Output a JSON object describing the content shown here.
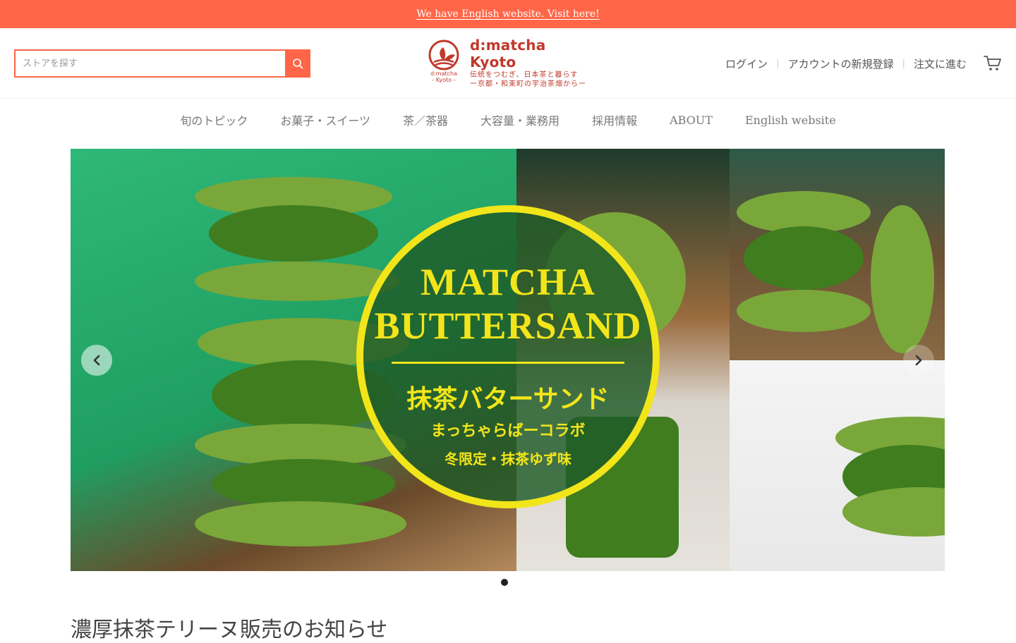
{
  "announcement": {
    "text": "We have English website. Visit here!"
  },
  "search": {
    "placeholder": "ストアを探す",
    "value": ""
  },
  "logo": {
    "mark_text": "d:matcha",
    "mark_sub": "- Kyoto -",
    "title": "d:matcha Kyoto",
    "tagline_1": "伝統をつむぎ、日本茶と暮らす",
    "tagline_2": "ー京都・和束町の宇治茶畑からー"
  },
  "account": {
    "login": "ログイン",
    "register": "アカウントの新規登録",
    "checkout": "注文に進む",
    "cart_icon": "cart-icon"
  },
  "nav": {
    "items": [
      {
        "label": "旬のトピック"
      },
      {
        "label": "お菓子・スイーツ"
      },
      {
        "label": "茶／茶器"
      },
      {
        "label": "大容量・業務用"
      },
      {
        "label": "採用情報"
      },
      {
        "label": "ABOUT"
      },
      {
        "label": "English website"
      }
    ]
  },
  "hero": {
    "title_line1": "MATCHA",
    "title_line2": "BUTTERSAND",
    "jp_title": "抹茶バターサンド",
    "jp_collab": "まっちゃらばーコラボ",
    "jp_flavor": "冬限定・抹茶ゆず味",
    "slides_total": 1,
    "active_slide": 1
  },
  "main": {
    "section_title": "濃厚抹茶テリーヌ販売のお知らせ"
  },
  "colors": {
    "accent": "#ff6647",
    "brand_red": "#c0392b",
    "badge_yellow": "#f2e51a"
  }
}
